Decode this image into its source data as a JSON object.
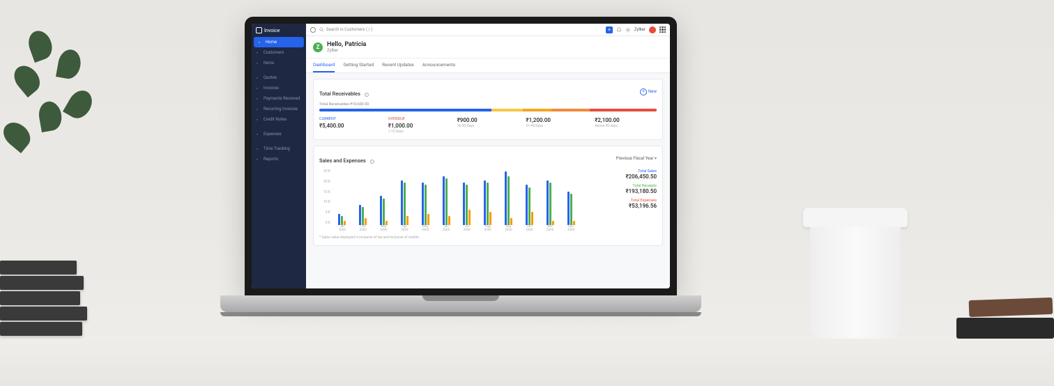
{
  "brand": "Invoice",
  "sidebar": {
    "items": [
      {
        "label": "Home",
        "icon": "home-icon",
        "active": true
      },
      {
        "label": "Customers",
        "icon": "customers-icon"
      },
      {
        "label": "Items",
        "icon": "items-icon"
      },
      {
        "label": "Quotes",
        "icon": "quotes-icon"
      },
      {
        "label": "Invoices",
        "icon": "invoices-icon"
      },
      {
        "label": "Payments Received",
        "icon": "payments-icon"
      },
      {
        "label": "Recurring Invoices",
        "icon": "recurring-icon"
      },
      {
        "label": "Credit Notes",
        "icon": "credit-icon"
      },
      {
        "label": "Expenses",
        "icon": "expenses-icon"
      },
      {
        "label": "Time Tracking",
        "icon": "time-icon"
      },
      {
        "label": "Reports",
        "icon": "reports-icon"
      }
    ]
  },
  "topbar": {
    "search_placeholder": "Search in Customers ( / )",
    "org": "Zylker"
  },
  "greeting": {
    "title": "Hello, Patricia",
    "subtitle": "Zylker",
    "logo_letter": "Z"
  },
  "tabs": [
    "Dashboard",
    "Getting Started",
    "Recent Updates",
    "Announcements"
  ],
  "receivables": {
    "title": "Total Receivables",
    "new": "New",
    "subtitle": "Total Receivables ₹10,600.00",
    "segments": [
      {
        "color": "#2563eb",
        "flex": 54
      },
      {
        "color": "#f9c846",
        "flex": 10
      },
      {
        "color": "#f5a623",
        "flex": 9
      },
      {
        "color": "#f08b3c",
        "flex": 12
      },
      {
        "color": "#e74c3c",
        "flex": 21
      }
    ],
    "cols": [
      {
        "label": "CURRENT",
        "value": "₹5,400.00",
        "sub": "",
        "cls": "cur"
      },
      {
        "label": "OVERDUE",
        "value": "₹1,000.00",
        "sub": "1-15 Days",
        "cls": "ov"
      },
      {
        "label": "",
        "value": "₹900.00",
        "sub": "16-30 Days"
      },
      {
        "label": "",
        "value": "₹1,200.00",
        "sub": "31-45 Days"
      },
      {
        "label": "",
        "value": "₹2,100.00",
        "sub": "Above 45 days"
      }
    ]
  },
  "sales": {
    "title": "Sales and Expenses",
    "dropdown": "Previous Fiscal Year",
    "footnote": "* Sales value displayed is inclusive of tax and inclusive of credits.",
    "totals": [
      {
        "label": "Total Sales",
        "value": "₹206,450.50",
        "cls": "ts"
      },
      {
        "label": "Total Receipts",
        "value": "₹193,180.50",
        "cls": "tr"
      },
      {
        "label": "Total Expenses",
        "value": "₹53,196.56",
        "cls": "te"
      }
    ]
  },
  "chart_data": {
    "type": "bar",
    "title": "Sales and Expenses",
    "xlabel": "",
    "ylabel": "",
    "ylim": [
      0,
      25
    ],
    "yticks": [
      "25 K",
      "20 K",
      "15 K",
      "10 K",
      "5 K",
      "0 K"
    ],
    "categories": [
      "Jan 2000",
      "Feb 2000",
      "Mar 2000",
      "Apr 2000",
      "May 2000",
      "Jun 2000",
      "Jul 2000",
      "Aug 2000",
      "Sep 2000",
      "Oct 2000",
      "Nov 2000",
      "Dec 2000"
    ],
    "series": [
      {
        "name": "Sales",
        "color": "#2563eb",
        "values": [
          5,
          9,
          13,
          20,
          19,
          22,
          19,
          20,
          24,
          18,
          20,
          15
        ]
      },
      {
        "name": "Receipts",
        "color": "#4caf50",
        "values": [
          4,
          8,
          12,
          19,
          18,
          21,
          18,
          19,
          22,
          17,
          19,
          14
        ]
      },
      {
        "name": "Expenses",
        "color": "#ff9800",
        "values": [
          2,
          3,
          2,
          4,
          5,
          4,
          7,
          6,
          3,
          6,
          2,
          2
        ]
      }
    ]
  }
}
